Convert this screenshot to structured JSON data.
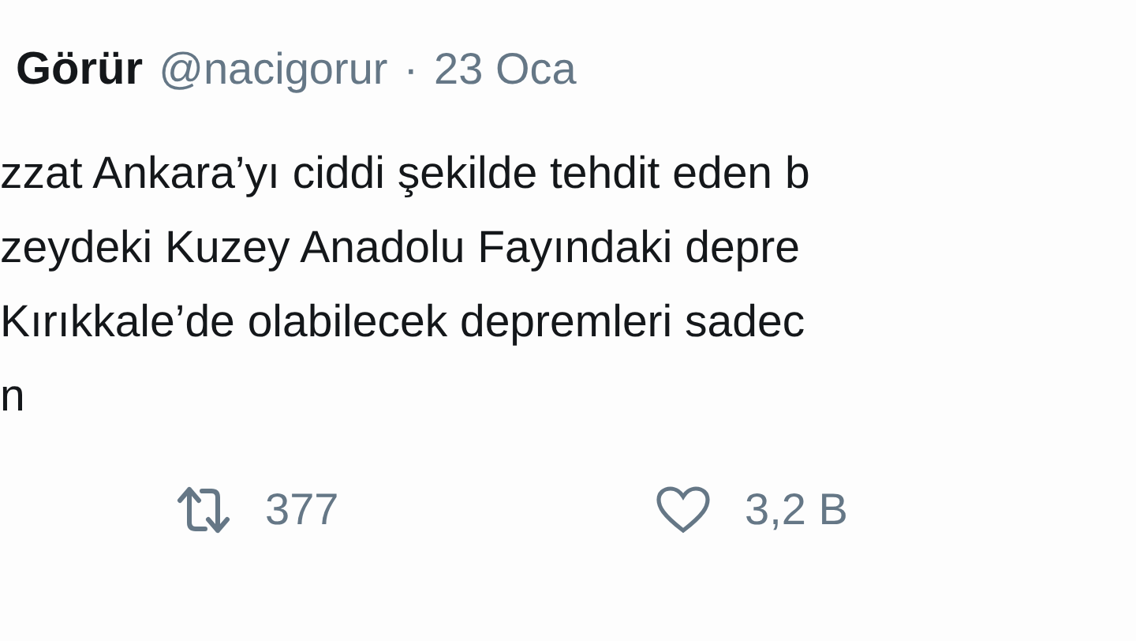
{
  "tweet": {
    "author_name": "Görür",
    "handle": "@nacigorur",
    "separator": "·",
    "date": "23 Oca",
    "body_lines": [
      "zzat Ankara’yı ciddi şekilde tehdit eden b",
      "zeydeki Kuzey Anadolu Fayındaki depre",
      "Kırıkkale’de olabilecek depremleri sadec",
      "n"
    ],
    "actions": [
      {
        "kind": "retweet",
        "count": "377"
      },
      {
        "kind": "like",
        "count": "3,2 B"
      }
    ]
  }
}
